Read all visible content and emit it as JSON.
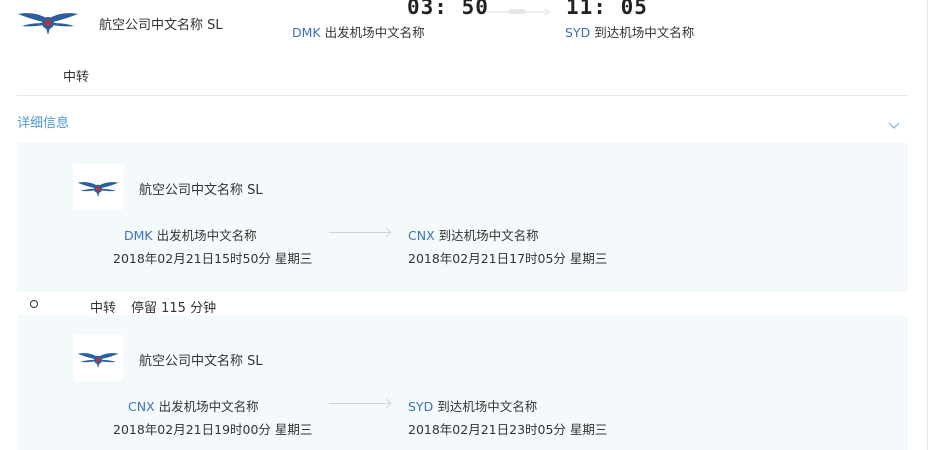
{
  "summary": {
    "airline_name": "航空公司中文名称 SL",
    "dep_time": "03: 50",
    "arr_time": "11: 05",
    "dep_code": "DMK",
    "dep_airport": "出发机场中文名称",
    "arr_code": "SYD",
    "arr_airport": "到达机场中文名称",
    "transfer_label": "中转"
  },
  "details": {
    "toggle_label": "详细信息",
    "toggle_icon": "chevron-down-icon"
  },
  "segments": [
    {
      "airline_name": "航空公司中文名称 SL",
      "dep_code": "DMK",
      "dep_airport": "出发机场中文名称",
      "dep_datetime": "2018年02月21日15时50分 星期三",
      "arr_code": "CNX",
      "arr_airport": "到达机场中文名称",
      "arr_datetime": "2018年02月21日17时05分 星期三"
    },
    {
      "airline_name": "航空公司中文名称 SL",
      "dep_code": "CNX",
      "dep_airport": "出发机场中文名称",
      "dep_datetime": "2018年02月21日19时00分 星期三",
      "arr_code": "SYD",
      "arr_airport": "到达机场中文名称",
      "arr_datetime": "2018年02月21日23时05分 星期三"
    }
  ],
  "transfer": {
    "label": "中转",
    "stay_text": "停留 115 分钟"
  },
  "colors": {
    "code_blue": "#3e72b8",
    "link_blue": "#4a9ad4",
    "card_bg": "#f4fafb",
    "logo_blue": "#2a5f9e",
    "logo_red": "#c8302c"
  }
}
